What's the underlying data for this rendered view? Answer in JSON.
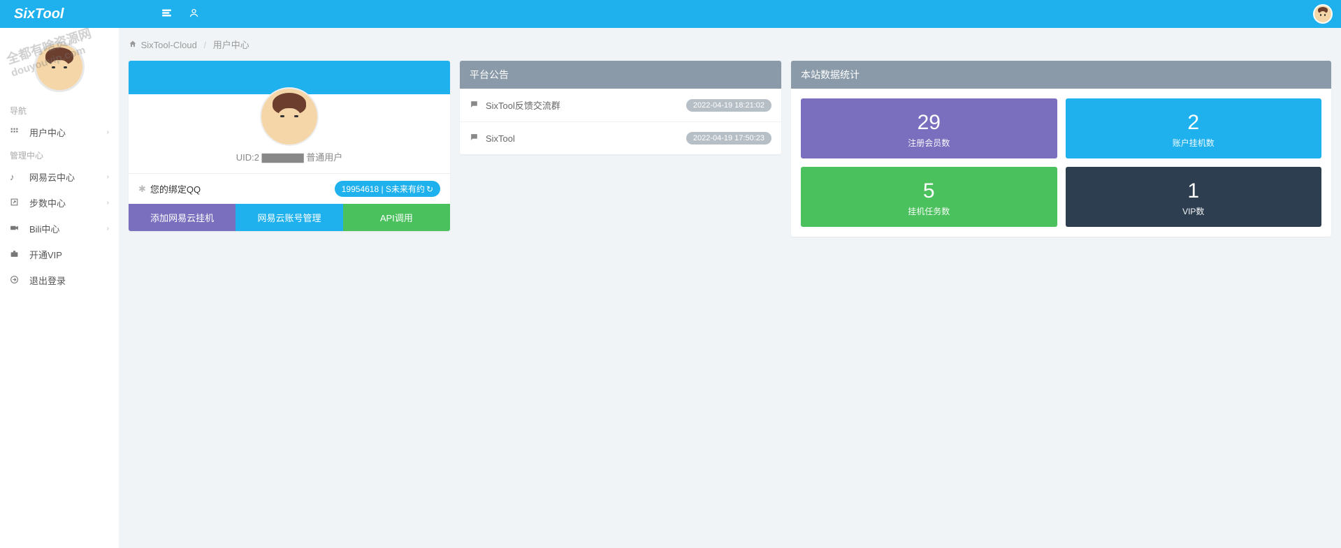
{
  "app": {
    "brand": "SixTool"
  },
  "breadcrumb": {
    "root": "SixTool-Cloud",
    "current": "用户中心"
  },
  "sidebar": {
    "section_nav": "导航",
    "section_admin": "管理中心",
    "items_nav": [
      {
        "label": "用户中心",
        "chev": true
      }
    ],
    "items_admin": [
      {
        "label": "网易云中心",
        "chev": true
      },
      {
        "label": "步数中心",
        "chev": true
      },
      {
        "label": "Bili中心",
        "chev": true
      },
      {
        "label": "开通VIP",
        "chev": false
      },
      {
        "label": "退出登录",
        "chev": false
      }
    ]
  },
  "profile": {
    "uid_text": "UID:2 ▇▇▇▇▇▇ 普通用户",
    "qq_label": "您的绑定QQ",
    "badge": "19954618 | S未来有约",
    "buttons": {
      "add": "添加网易云挂机",
      "manage": "网易云账号管理",
      "api": "API调用"
    }
  },
  "announcements": {
    "header": "平台公告",
    "items": [
      {
        "title": "SixTool反馈交流群",
        "time": "2022-04-19 18:21:02"
      },
      {
        "title": "SixTool",
        "time": "2022-04-19 17:50:23"
      }
    ]
  },
  "stats": {
    "header": "本站数据统计",
    "items": [
      {
        "num": "29",
        "label": "注册会员数",
        "cls": "stat-purple"
      },
      {
        "num": "2",
        "label": "账户挂机数",
        "cls": "stat-cyan"
      },
      {
        "num": "5",
        "label": "挂机任务数",
        "cls": "stat-green"
      },
      {
        "num": "1",
        "label": "VIP数",
        "cls": "stat-dark"
      }
    ]
  },
  "watermark": {
    "line1": "全都有啥资源网",
    "line2": "douyouvip.com"
  }
}
